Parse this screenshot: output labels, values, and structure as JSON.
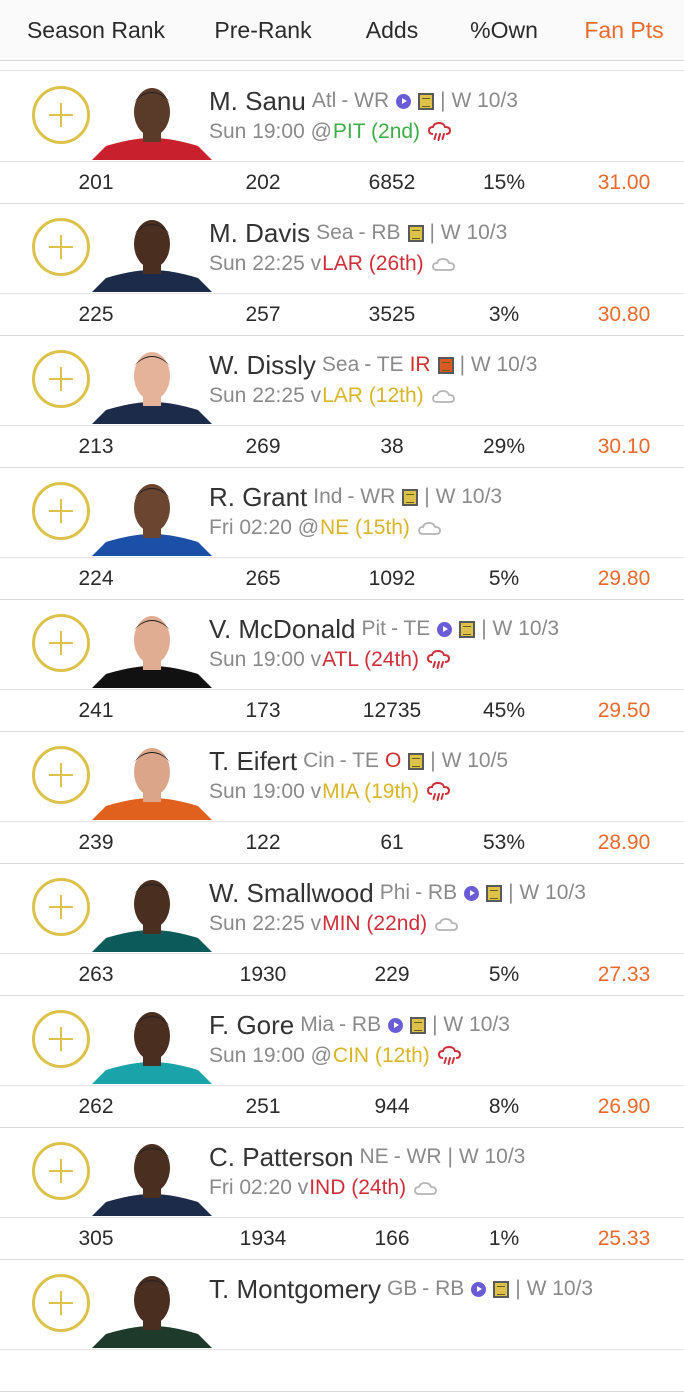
{
  "header": {
    "columns": [
      {
        "label": "Season Rank"
      },
      {
        "label": "Pre-Rank"
      },
      {
        "label": "Adds"
      },
      {
        "label": "%Own"
      },
      {
        "label": "Fan Pts"
      }
    ],
    "active_column": "Fan Pts"
  },
  "colors": {
    "accent": "#ea6a2d",
    "add_button": "#dcc24a",
    "good_matchup": "#3fae48",
    "bad_matchup": "#cf2f3a",
    "mid_matchup": "#d8b529"
  },
  "players": [
    {
      "name": "M. Sanu",
      "team": "Atl",
      "pos": "WR",
      "status": "",
      "video": true,
      "note": true,
      "note_color": "yellow",
      "week": "| W 10/3",
      "game_prefix": "Sun 19:00 @",
      "opponent": "PIT (2nd)",
      "opp_color": "green",
      "weather": "rain-icon",
      "stats": {
        "season_rank": "201",
        "pre_rank": "202",
        "adds": "6852",
        "own": "15%",
        "fan_pts": "31.00"
      },
      "jersey": "#c8202c",
      "skin": "#5a3a28"
    },
    {
      "name": "M. Davis",
      "team": "Sea",
      "pos": "RB",
      "status": "",
      "video": false,
      "note": true,
      "note_color": "yellow",
      "week": "| W 10/3",
      "game_prefix": "Sun 22:25 v ",
      "opponent": "LAR (26th)",
      "opp_color": "red",
      "weather": "cloud-icon",
      "stats": {
        "season_rank": "225",
        "pre_rank": "257",
        "adds": "3525",
        "own": "3%",
        "fan_pts": "30.80"
      },
      "jersey": "#1d2b4a",
      "skin": "#4a2e20"
    },
    {
      "name": "W. Dissly",
      "team": "Sea",
      "pos": "TE",
      "status": "IR",
      "video": false,
      "note": true,
      "note_color": "red",
      "week": "| W 10/3",
      "game_prefix": "Sun 22:25 v ",
      "opponent": "LAR (12th)",
      "opp_color": "yellow",
      "weather": "cloud-icon",
      "stats": {
        "season_rank": "213",
        "pre_rank": "269",
        "adds": "38",
        "own": "29%",
        "fan_pts": "30.10"
      },
      "jersey": "#1d2b4a",
      "skin": "#e5b39a"
    },
    {
      "name": "R. Grant",
      "team": "Ind",
      "pos": "WR",
      "status": "",
      "video": false,
      "note": true,
      "note_color": "yellow",
      "week": "| W 10/3",
      "game_prefix": "Fri 02:20 @",
      "opponent": "NE (15th)",
      "opp_color": "yellow",
      "weather": "cloud-icon",
      "stats": {
        "season_rank": "224",
        "pre_rank": "265",
        "adds": "1092",
        "own": "5%",
        "fan_pts": "29.80"
      },
      "jersey": "#1b4fa8",
      "skin": "#6b4530"
    },
    {
      "name": "V. McDonald",
      "team": "Pit",
      "pos": "TE",
      "status": "",
      "video": true,
      "note": true,
      "note_color": "yellow",
      "week": "| W 10/3",
      "game_prefix": "Sun 19:00 v ",
      "opponent": "ATL (24th)",
      "opp_color": "red",
      "weather": "rain-icon",
      "stats": {
        "season_rank": "241",
        "pre_rank": "173",
        "adds": "12735",
        "own": "45%",
        "fan_pts": "29.50"
      },
      "jersey": "#111111",
      "skin": "#e0ad92"
    },
    {
      "name": "T. Eifert",
      "team": "Cin",
      "pos": "TE",
      "status": "O",
      "video": false,
      "note": true,
      "note_color": "yellow",
      "week": "| W 10/5",
      "game_prefix": "Sun 19:00 v ",
      "opponent": "MIA (19th)",
      "opp_color": "yellow",
      "weather": "rain-icon",
      "stats": {
        "season_rank": "239",
        "pre_rank": "122",
        "adds": "61",
        "own": "53%",
        "fan_pts": "28.90"
      },
      "jersey": "#e0601e",
      "skin": "#dba58a"
    },
    {
      "name": "W. Smallwood",
      "team": "Phi",
      "pos": "RB",
      "status": "",
      "video": true,
      "note": true,
      "note_color": "yellow",
      "week": "| W 10/3",
      "game_prefix": "Sun 22:25 v ",
      "opponent": "MIN (22nd)",
      "opp_color": "red",
      "weather": "cloud-icon",
      "stats": {
        "season_rank": "263",
        "pre_rank": "1930",
        "adds": "229",
        "own": "5%",
        "fan_pts": "27.33"
      },
      "jersey": "#0d5a5a",
      "skin": "#4a2e20"
    },
    {
      "name": "F. Gore",
      "team": "Mia",
      "pos": "RB",
      "status": "",
      "video": true,
      "note": true,
      "note_color": "yellow",
      "week": "| W 10/3",
      "game_prefix": "Sun 19:00 @",
      "opponent": "CIN (12th)",
      "opp_color": "yellow",
      "weather": "rain-icon",
      "stats": {
        "season_rank": "262",
        "pre_rank": "251",
        "adds": "944",
        "own": "8%",
        "fan_pts": "26.90"
      },
      "jersey": "#1aa3a8",
      "skin": "#4a2e20"
    },
    {
      "name": "C. Patterson",
      "team": "NE",
      "pos": "WR",
      "status": "",
      "video": false,
      "note": false,
      "note_color": "",
      "week": "| W 10/3",
      "game_prefix": "Fri 02:20 v ",
      "opponent": "IND (24th)",
      "opp_color": "red",
      "weather": "cloud-icon",
      "stats": {
        "season_rank": "305",
        "pre_rank": "1934",
        "adds": "166",
        "own": "1%",
        "fan_pts": "25.33"
      },
      "jersey": "#1d2b4a",
      "skin": "#4a2e20"
    },
    {
      "name": "T. Montgomery",
      "team": "GB",
      "pos": "RB",
      "status": "",
      "video": true,
      "note": true,
      "note_color": "yellow",
      "week": "| W 10/3",
      "game_prefix": "",
      "opponent": "",
      "opp_color": "",
      "weather": "",
      "stats": {
        "season_rank": "",
        "pre_rank": "",
        "adds": "",
        "own": "",
        "fan_pts": ""
      },
      "jersey": "#1d3a2a",
      "skin": "#4a2e20"
    }
  ]
}
